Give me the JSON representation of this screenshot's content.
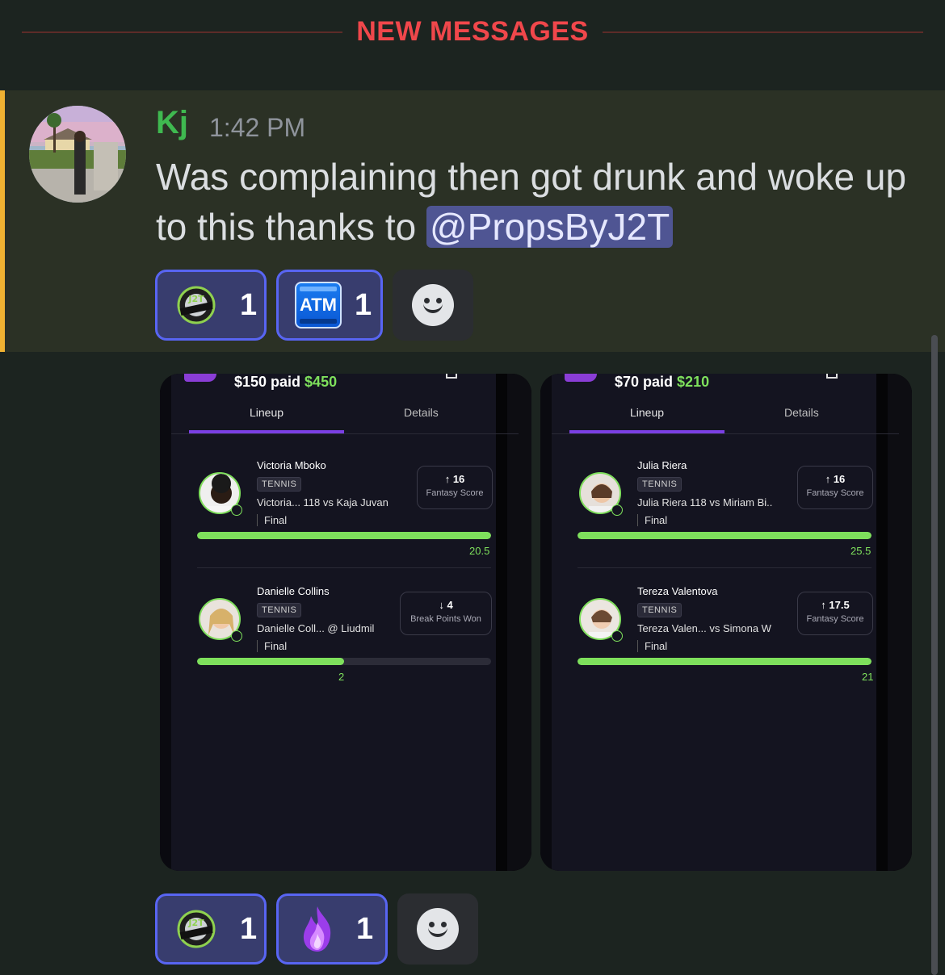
{
  "divider": {
    "label": "NEW MESSAGES"
  },
  "message": {
    "username": "Kj",
    "timestamp": "1:42 PM",
    "text_before": "Was complaining then got drunk and woke up to this thanks to ",
    "mention": "@PropsByJ2T",
    "reactions": [
      {
        "icon": "j2t-sportscapper-emoji",
        "count": "1"
      },
      {
        "icon": "atm-emoji",
        "count": "1",
        "badge_text": "ATM"
      }
    ],
    "add_reaction_icon": "smiley-add-reaction-icon"
  },
  "attachments": [
    {
      "paid": "$150 paid ",
      "win": "$450",
      "tabs": [
        "Lineup",
        "Details"
      ],
      "players": [
        {
          "name": "Victoria Mboko",
          "sport": "TENNIS",
          "matchup": "Victoria... 118 vs Kaja Juvan",
          "status": "Final",
          "arrow": "↑",
          "score": "16",
          "score_label": "Fantasy Score",
          "result": "20.5",
          "progress": 1.0
        },
        {
          "name": "Danielle Collins",
          "sport": "TENNIS",
          "matchup": "Danielle Coll... @ Liudmil",
          "status": "Final",
          "arrow": "↓",
          "score": "4",
          "score_label": "Break Points Won",
          "result": "2",
          "progress": 0.5
        }
      ]
    },
    {
      "paid": "$70 paid ",
      "win": "$210",
      "tabs": [
        "Lineup",
        "Details"
      ],
      "players": [
        {
          "name": "Julia Riera",
          "sport": "TENNIS",
          "matchup": "Julia Riera 118 vs Miriam Bi..",
          "status": "Final",
          "arrow": "↑",
          "score": "16",
          "score_label": "Fantasy Score",
          "result": "25.5",
          "progress": 1.0
        },
        {
          "name": "Tereza Valentova",
          "sport": "TENNIS",
          "matchup": "Tereza Valen... vs Simona W",
          "status": "Final",
          "arrow": "↑",
          "score": "17.5",
          "score_label": "Fantasy Score",
          "result": "21",
          "progress": 1.0
        }
      ]
    }
  ],
  "bottom_reactions": [
    {
      "icon": "j2t-sportscapper-emoji",
      "count": "1"
    },
    {
      "icon": "purple-fire-emoji",
      "count": "1"
    }
  ],
  "colors": {
    "accent": "#5865f2",
    "username": "#3fb950",
    "new_messages": "#f0474b",
    "highlight_bar": "#f0b232",
    "win_green": "#7ee05c"
  }
}
